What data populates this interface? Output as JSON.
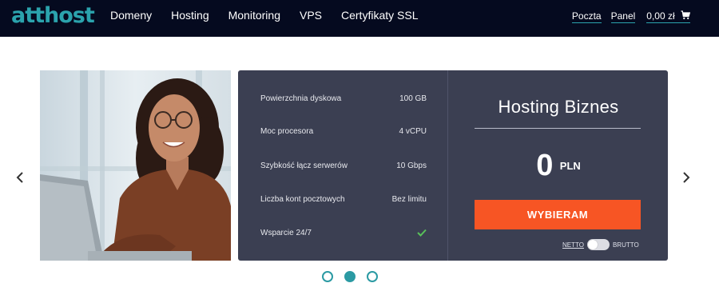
{
  "brand": {
    "logo_text": "atthost",
    "accent_color": "#2ba3ad"
  },
  "nav": {
    "items": [
      {
        "label": "Domeny"
      },
      {
        "label": "Hosting"
      },
      {
        "label": "Monitoring"
      },
      {
        "label": "VPS"
      },
      {
        "label": "Certyfikaty SSL"
      }
    ],
    "right": {
      "mail_label": "Poczta",
      "panel_label": "Panel",
      "cart_label": "0,00 zł",
      "cart_icon": "shopping-cart-icon"
    }
  },
  "carousel": {
    "prev_icon": "chevron-left-icon",
    "next_icon": "chevron-right-icon",
    "slide_count": 3,
    "active_index": 1
  },
  "plan": {
    "specs": [
      {
        "label": "Powierzchnia dyskowa",
        "value": "100 GB"
      },
      {
        "label": "Moc procesora",
        "value": "4 vCPU"
      },
      {
        "label": "Szybkość łącz serwerów",
        "value": "10 Gbps"
      },
      {
        "label": "Liczba kont pocztowych",
        "value": "Bez limitu"
      },
      {
        "label": "Wsparcie 24/7",
        "value": "",
        "icon": "check-icon"
      }
    ],
    "name": "Hosting Biznes",
    "price": "0",
    "currency": "PLN",
    "cta_label": "WYBIERAM",
    "cta_color": "#f75524",
    "toggle": {
      "left_label": "NETTO",
      "right_label": "BRUTTO",
      "selected": "NETTO"
    }
  }
}
